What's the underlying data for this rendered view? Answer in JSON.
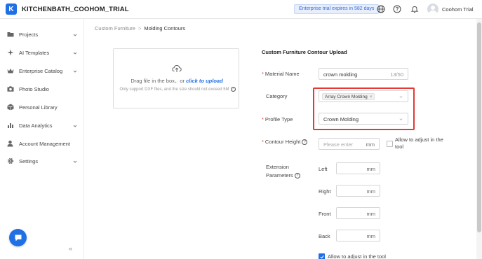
{
  "header": {
    "logo_letter": "K",
    "title": "KITCHENBATH_COOHOM_TRIAL",
    "trial_badge": "Enterprise trial expires in 582 days",
    "user_name": "Coohom Trial",
    "icons": [
      "globe-icon",
      "help-icon",
      "bell-icon"
    ]
  },
  "sidebar": {
    "items": [
      {
        "label": "Projects",
        "icon": "folder-icon",
        "expandable": true
      },
      {
        "label": "AI Templates",
        "icon": "ai-icon",
        "expandable": true
      },
      {
        "label": "Enterprise Catalog",
        "icon": "crown-icon",
        "expandable": true
      },
      {
        "label": "Photo Studio",
        "icon": "camera-icon",
        "expandable": false
      },
      {
        "label": "Personal Library",
        "icon": "cube-icon",
        "expandable": false
      },
      {
        "label": "Data Analytics",
        "icon": "chart-icon",
        "expandable": true
      },
      {
        "label": "Account Management",
        "icon": "user-icon",
        "expandable": false
      },
      {
        "label": "Settings",
        "icon": "gear-icon",
        "expandable": true
      }
    ],
    "collapse_label": "«"
  },
  "breadcrumb": {
    "parent": "Custom Furniture",
    "separator": ">",
    "current": "Molding Contours"
  },
  "upload": {
    "main_text": "Drag file in the box、or ",
    "link_text": "click to upload",
    "sub_text": "Only support DXF files, and the size should not exceed 5M"
  },
  "form": {
    "title": "Custom Furniture Contour Upload",
    "material_name": {
      "label": "Material Name",
      "required": true,
      "value": "crown molding",
      "count": "13/50"
    },
    "category": {
      "label": "Category",
      "required": false,
      "tag": "Array Crown Molding",
      "tag_close": "×"
    },
    "profile_type": {
      "label": "Profile Type",
      "required": true,
      "value": "Crown Molding"
    },
    "contour_height": {
      "label": "Contour Height",
      "required": true,
      "placeholder": "Please enter",
      "unit": "mm",
      "allow_label": "Allow to adjust in the tool",
      "allow_checked": false
    },
    "extension": {
      "label_line1": "Extension",
      "label_line2": "Parameters",
      "fields": [
        {
          "label": "Left",
          "unit": "mm"
        },
        {
          "label": "Right",
          "unit": "mm"
        },
        {
          "label": "Front",
          "unit": "mm"
        },
        {
          "label": "Back",
          "unit": "mm"
        }
      ],
      "allow_label": "Allow to adjust in the tool",
      "allow_checked": true
    }
  },
  "colors": {
    "accent": "#1f6fe5",
    "highlight": "#e53935"
  }
}
